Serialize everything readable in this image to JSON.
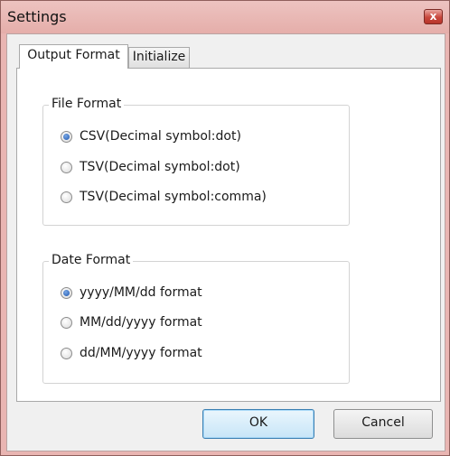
{
  "window": {
    "title": "Settings",
    "close_glyph": "x"
  },
  "tabs": [
    {
      "label": "Output Format",
      "active": true
    },
    {
      "label": "Initialize",
      "active": false
    }
  ],
  "file_format": {
    "legend": "File Format",
    "options": [
      {
        "label": "CSV(Decimal symbol:dot)",
        "checked": true
      },
      {
        "label": "TSV(Decimal symbol:dot)",
        "checked": false
      },
      {
        "label": "TSV(Decimal symbol:comma)",
        "checked": false
      }
    ]
  },
  "date_format": {
    "legend": "Date Format",
    "options": [
      {
        "label": "yyyy/MM/dd format",
        "checked": true
      },
      {
        "label": "MM/dd/yyyy format",
        "checked": false
      },
      {
        "label": "dd/MM/yyyy format",
        "checked": false
      }
    ]
  },
  "buttons": {
    "ok": "OK",
    "cancel": "Cancel"
  },
  "colors": {
    "title_bar": "#e9b5b2",
    "radio_selected": "#1d56b0",
    "default_button_border": "#3c7fb1"
  }
}
